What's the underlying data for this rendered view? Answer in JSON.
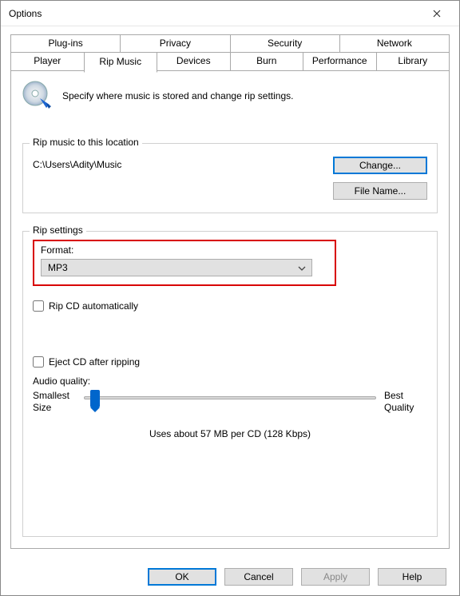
{
  "window": {
    "title": "Options"
  },
  "tabs_row1": [
    "Plug-ins",
    "Privacy",
    "Security",
    "Network"
  ],
  "tabs_row2": [
    "Player",
    "Rip Music",
    "Devices",
    "Burn",
    "Performance",
    "Library"
  ],
  "active_tab": "Rip Music",
  "header": {
    "desc": "Specify where music is stored and change rip settings."
  },
  "location_group": {
    "legend": "Rip music to this location",
    "path": "C:\\Users\\Adity\\Music",
    "change_btn": "Change...",
    "filename_btn": "File Name..."
  },
  "settings_group": {
    "legend": "Rip settings",
    "format_label": "Format:",
    "format_value": "MP3",
    "rip_auto_label": "Rip CD automatically",
    "eject_label": "Eject CD after ripping",
    "audio_quality_label": "Audio quality:",
    "slider_left_l1": "Smallest",
    "slider_left_l2": "Size",
    "slider_right_l1": "Best",
    "slider_right_l2": "Quality",
    "slider_hint": "Uses about 57 MB per CD (128 Kbps)"
  },
  "footer": {
    "ok": "OK",
    "cancel": "Cancel",
    "apply": "Apply",
    "help": "Help"
  }
}
